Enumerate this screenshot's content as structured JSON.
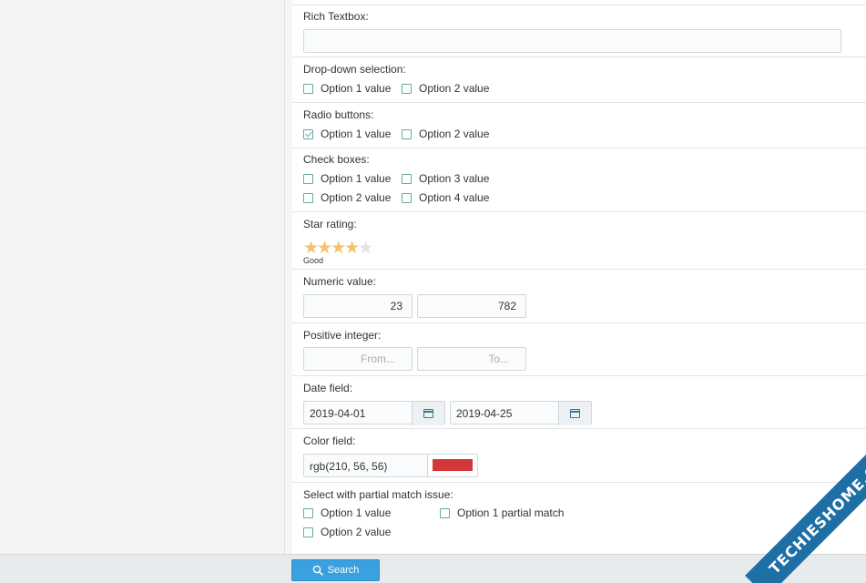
{
  "fields": {
    "rich_textbox": {
      "label": "Rich Textbox:",
      "value": ""
    },
    "dropdown": {
      "label": "Drop-down selection:",
      "options": [
        {
          "label": "Option 1 value",
          "checked": false
        },
        {
          "label": "Option 2 value",
          "checked": false
        }
      ]
    },
    "radio": {
      "label": "Radio buttons:",
      "options": [
        {
          "label": "Option 1 value",
          "checked": true
        },
        {
          "label": "Option 2 value",
          "checked": false
        }
      ]
    },
    "checkboxes": {
      "label": "Check boxes:",
      "options": [
        {
          "label": "Option 1 value",
          "checked": false
        },
        {
          "label": "Option 3 value",
          "checked": false
        },
        {
          "label": "Option 2 value",
          "checked": false
        },
        {
          "label": "Option 4 value",
          "checked": false
        }
      ]
    },
    "star_rating": {
      "label": "Star rating:",
      "rating": 4,
      "max": 5,
      "text": "Good"
    },
    "numeric": {
      "label": "Numeric value:",
      "from": "23",
      "to": "782"
    },
    "positive_integer": {
      "label": "Positive integer:",
      "from_placeholder": "From...",
      "to_placeholder": "To..."
    },
    "date": {
      "label": "Date field:",
      "from": "2019-04-01",
      "to": "2019-04-25",
      "icon": "calendar-icon"
    },
    "color": {
      "label": "Color field:",
      "value": "rgb(210, 56, 56)",
      "swatch": "#d23838"
    },
    "partial_match": {
      "label": "Select with partial match issue:",
      "options": [
        {
          "label": "Option 1 value",
          "checked": false
        },
        {
          "label": "Option 1 partial match",
          "checked": false
        },
        {
          "label": "Option 2 value",
          "checked": false
        }
      ]
    }
  },
  "footer": {
    "search_label": "Search",
    "icon": "search-icon"
  },
  "watermark": {
    "text": "TECHIESHOME.COM"
  },
  "colors": {
    "accent": "#3aa0de",
    "checkbox": "#6aa8a3",
    "star": "#f5c26b",
    "watermark_bg": "#1d6fa5"
  }
}
